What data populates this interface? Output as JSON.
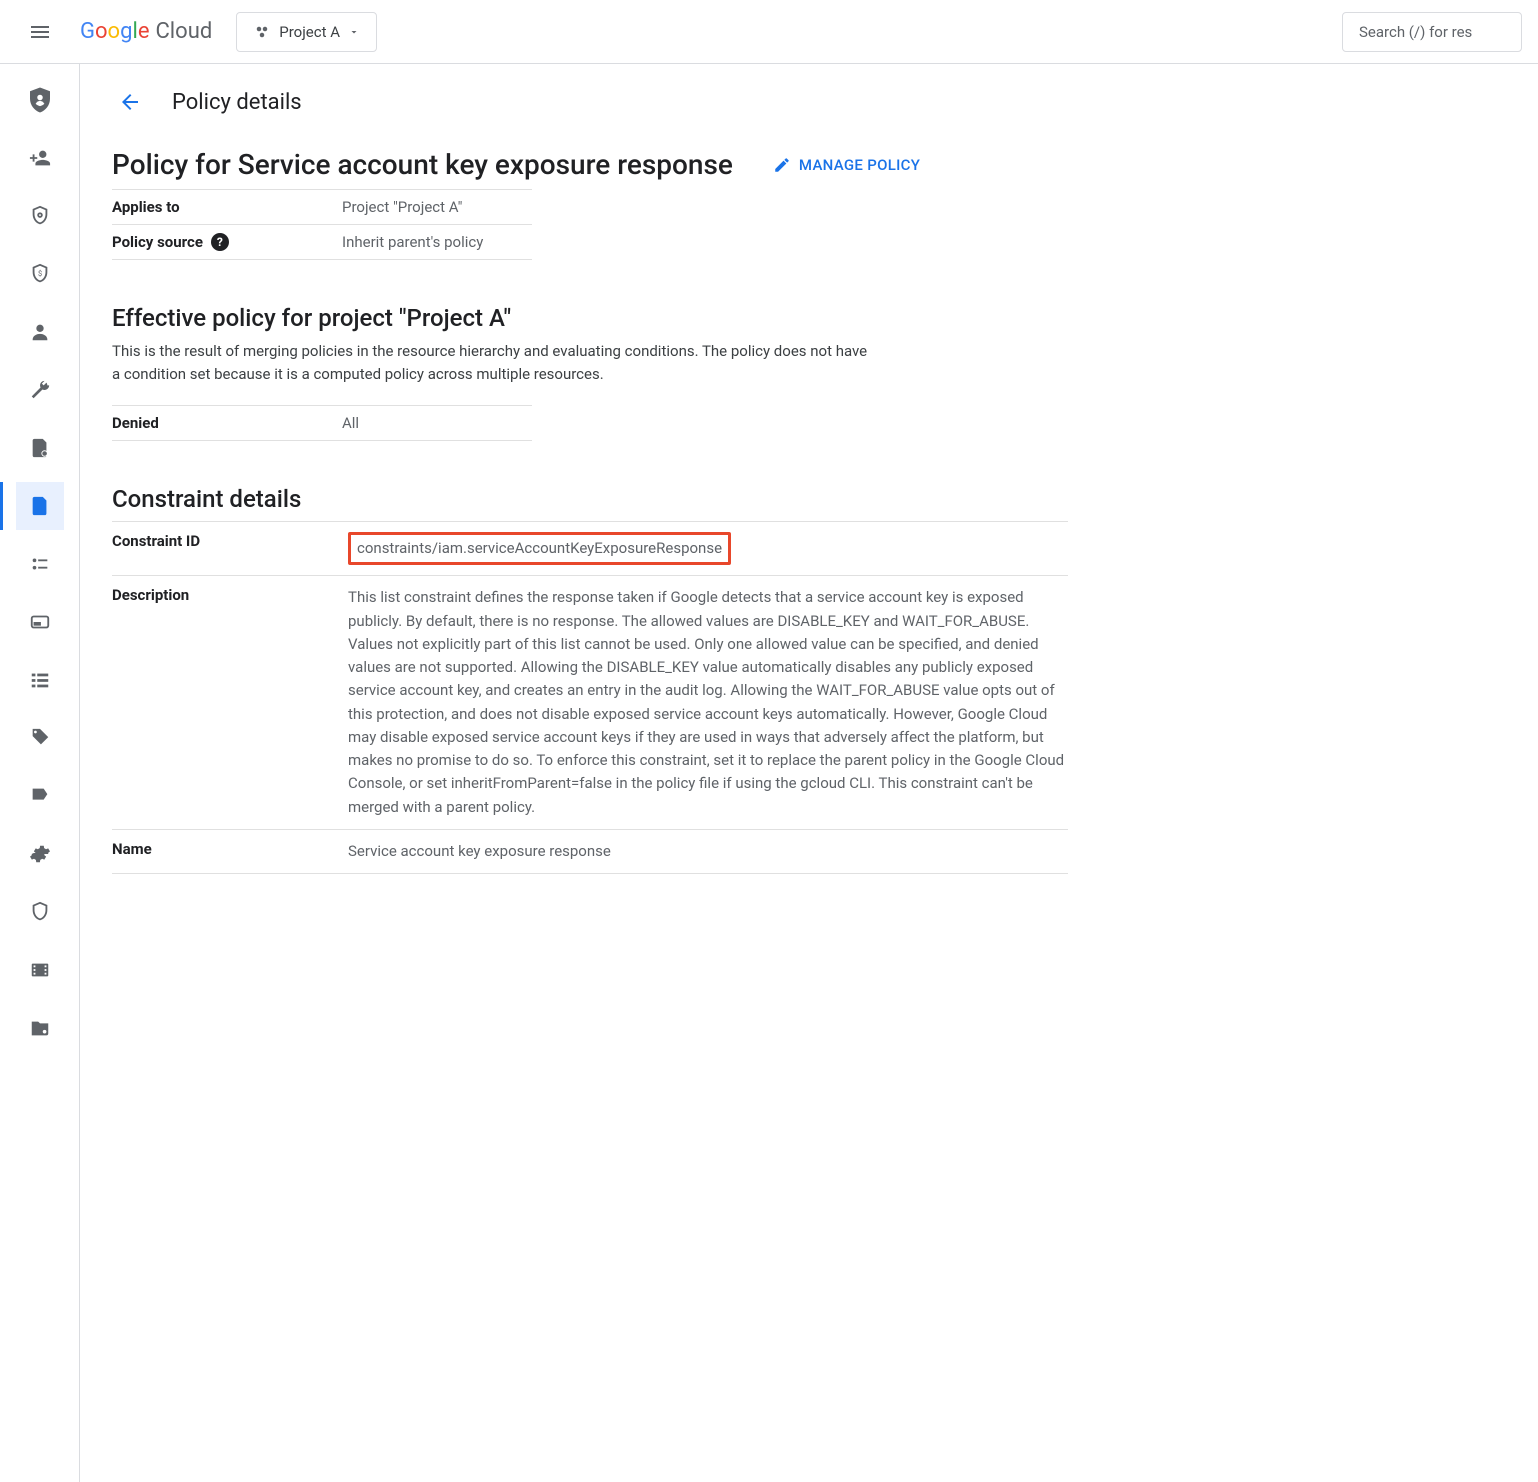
{
  "header": {
    "brand_word_google": "Google",
    "brand_word_cloud": "Cloud",
    "project_label": "Project A",
    "search_placeholder": "Search (/) for res"
  },
  "page": {
    "title": "Policy details"
  },
  "policy": {
    "heading": "Policy for Service account key exposure response",
    "manage_label": "MANAGE POLICY",
    "applies_to_label": "Applies to",
    "applies_to_value": "Project \"Project A\"",
    "source_label": "Policy source",
    "source_value": "Inherit parent's policy"
  },
  "effective": {
    "heading": "Effective policy for project \"Project A\"",
    "description": "This is the result of merging policies in the resource hierarchy and evaluating conditions. The policy does not have a condition set because it is a computed policy across multiple resources.",
    "denied_label": "Denied",
    "denied_value": "All"
  },
  "constraint": {
    "heading": "Constraint details",
    "id_label": "Constraint ID",
    "id_value": "constraints/iam.serviceAccountKeyExposureResponse",
    "description_label": "Description",
    "description_value": "This list constraint defines the response taken if Google detects that a service account key is exposed publicly. By default, there is no response. The allowed values are DISABLE_KEY and WAIT_FOR_ABUSE. Values not explicitly part of this list cannot be used. Only one allowed value can be specified, and denied values are not supported. Allowing the DISABLE_KEY value automatically disables any publicly exposed service account key, and creates an entry in the audit log. Allowing the WAIT_FOR_ABUSE value opts out of this protection, and does not disable exposed service account keys automatically. However, Google Cloud may disable exposed service account keys if they are used in ways that adversely affect the platform, but makes no promise to do so. To enforce this constraint, set it to replace the parent policy in the Google Cloud Console, or set inheritFromParent=false in the policy file if using the gcloud CLI. This constraint can't be merged with a parent policy.",
    "name_label": "Name",
    "name_value": "Service account key exposure response"
  },
  "sidebar": {
    "items": [
      {
        "name": "iam-admin",
        "icon": "shield-user"
      },
      {
        "name": "add-member",
        "icon": "person-plus"
      },
      {
        "name": "policy-analyzer",
        "icon": "shield-lock"
      },
      {
        "name": "workload-identity",
        "icon": "shield-currency"
      },
      {
        "name": "service-accounts",
        "icon": "person"
      },
      {
        "name": "tools",
        "icon": "wrench"
      },
      {
        "name": "organization-policies-a",
        "icon": "document-gear"
      },
      {
        "name": "organization-policies",
        "icon": "document",
        "active": true
      },
      {
        "name": "labels",
        "icon": "key-list"
      },
      {
        "name": "quotas",
        "icon": "card"
      },
      {
        "name": "groups",
        "icon": "list"
      },
      {
        "name": "tags",
        "icon": "tag"
      },
      {
        "name": "privacy",
        "icon": "bookmark"
      },
      {
        "name": "settings",
        "icon": "gear"
      },
      {
        "name": "security",
        "icon": "shield-outline"
      },
      {
        "name": "roles",
        "icon": "film"
      },
      {
        "name": "folder",
        "icon": "folder-gear"
      }
    ]
  }
}
